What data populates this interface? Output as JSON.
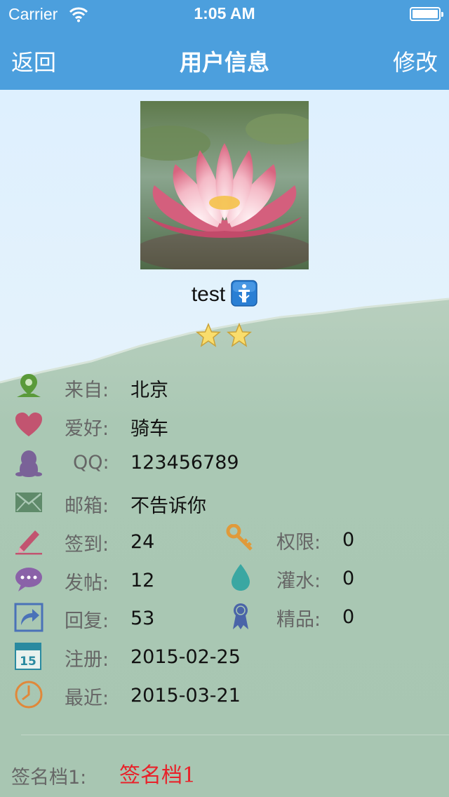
{
  "status_bar": {
    "carrier": "Carrier",
    "time": "1:05 AM"
  },
  "nav": {
    "back_label": "返回",
    "title": "用户信息",
    "edit_label": "修改"
  },
  "profile": {
    "username": "test",
    "stars": 2
  },
  "fields": {
    "from": {
      "label": "来自:",
      "value": "北京"
    },
    "hobby": {
      "label": "爱好:",
      "value": "骑车"
    },
    "qq": {
      "label": "QQ:",
      "value": "123456789"
    },
    "email": {
      "label": "邮箱:",
      "value": "不告诉你"
    },
    "checkin": {
      "label": "签到:",
      "value": "24"
    },
    "permission": {
      "label": "权限:",
      "value": "0"
    },
    "posts": {
      "label": "发帖:",
      "value": "12"
    },
    "water": {
      "label": "灌水:",
      "value": "0"
    },
    "replies": {
      "label": "回复:",
      "value": "53"
    },
    "featured": {
      "label": "精品:",
      "value": "0"
    },
    "registered": {
      "label": "注册:",
      "value": "2015-02-25"
    },
    "recent": {
      "label": "最近:",
      "value": "2015-03-21"
    }
  },
  "signature": {
    "label": "签名档1:",
    "value": "签名档1"
  },
  "colors": {
    "nav_bar": "#4c9fdd",
    "signature_text": "#e8222a",
    "background": "#aac8b4"
  }
}
